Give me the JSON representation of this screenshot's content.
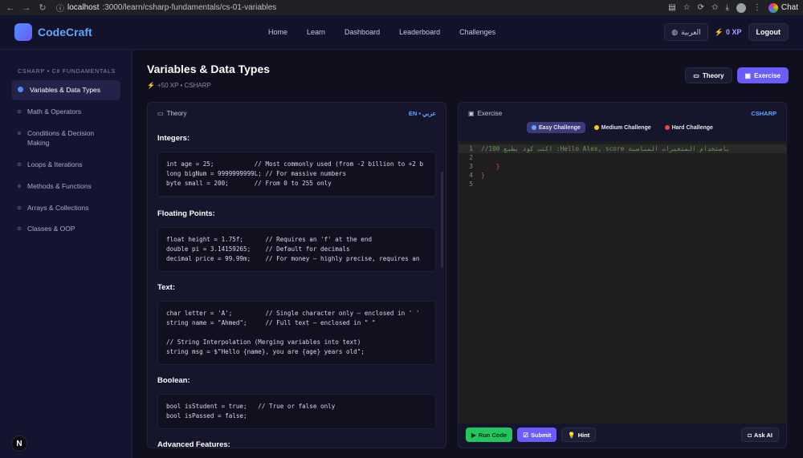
{
  "browser": {
    "url_host": "localhost",
    "url_path": ":3000/learn/csharp-fundamentals/cs-01-variables",
    "chat_label": "Chat"
  },
  "header": {
    "brand": "CodeCraft",
    "nav": [
      "Home",
      "Learn",
      "Dashboard",
      "Leaderboard",
      "Challenges"
    ],
    "lang_label": "العربية",
    "xp": "0 XP",
    "logout": "Logout"
  },
  "sidebar": {
    "heading": "CSHARP • C# FUNDAMENTALS",
    "items": [
      {
        "label": "Variables & Data Types"
      },
      {
        "label": "Math & Operators"
      },
      {
        "label": "Conditions & Decision Making"
      },
      {
        "label": "Loops & Iterations"
      },
      {
        "label": "Methods & Functions"
      },
      {
        "label": "Arrays & Collections"
      },
      {
        "label": "Classes & OOP"
      }
    ],
    "badge": "N"
  },
  "lesson": {
    "title": "Variables & Data Types",
    "meta": "+50 XP • CSHARP",
    "theory_btn": "Theory",
    "exercise_btn": "Exercise"
  },
  "theory": {
    "header": "Theory",
    "lang_tag": "EN • عربي",
    "sections": [
      {
        "heading": "Integers:",
        "code": "int age = 25;           // Most commonly used (from -2 billion to +2 b\nlong bigNum = 9999999999L; // For massive numbers\nbyte small = 200;       // From 0 to 255 only"
      },
      {
        "heading": "Floating Points:",
        "code": "float height = 1.75f;      // Requires an 'f' at the end\ndouble pi = 3.14159265;    // Default for decimals\ndecimal price = 99.99m;    // For money — highly precise, requires an"
      },
      {
        "heading": "Text:",
        "code": "char letter = 'A';         // Single character only — enclosed in ' '\nstring name = \"Ahmed\";     // Full text — enclosed in \" \"\n\n// String Interpolation (Merging variables into text)\nstring msg = $\"Hello {name}, you are {age} years old\";"
      },
      {
        "heading": "Boolean:",
        "code": "bool isStudent = true;   // True or false only\nbool isPassed = false;"
      }
    ],
    "cut_heading": "Advanced Features:"
  },
  "exercise": {
    "header": "Exercise",
    "lang_tag": "CSHARP",
    "difficulties": [
      {
        "label": "Easy Challenge",
        "color": "#60a5fa"
      },
      {
        "label": "Medium Challenge",
        "color": "#facc15"
      },
      {
        "label": "Hard Challenge",
        "color": "#ef4444"
      }
    ],
    "code_lines": [
      {
        "n": "1",
        "text": "//اكتب كود يطبع 100 :Hello Alex, score باستخدام المتغيرات المناسبة"
      },
      {
        "n": "2",
        "text": ""
      },
      {
        "n": "3",
        "text": "    }"
      },
      {
        "n": "4",
        "text": "}"
      },
      {
        "n": "5",
        "text": ""
      }
    ],
    "run": "Run Code",
    "submit": "Submit",
    "hint": "Hint",
    "ask_ai": "Ask AI"
  }
}
